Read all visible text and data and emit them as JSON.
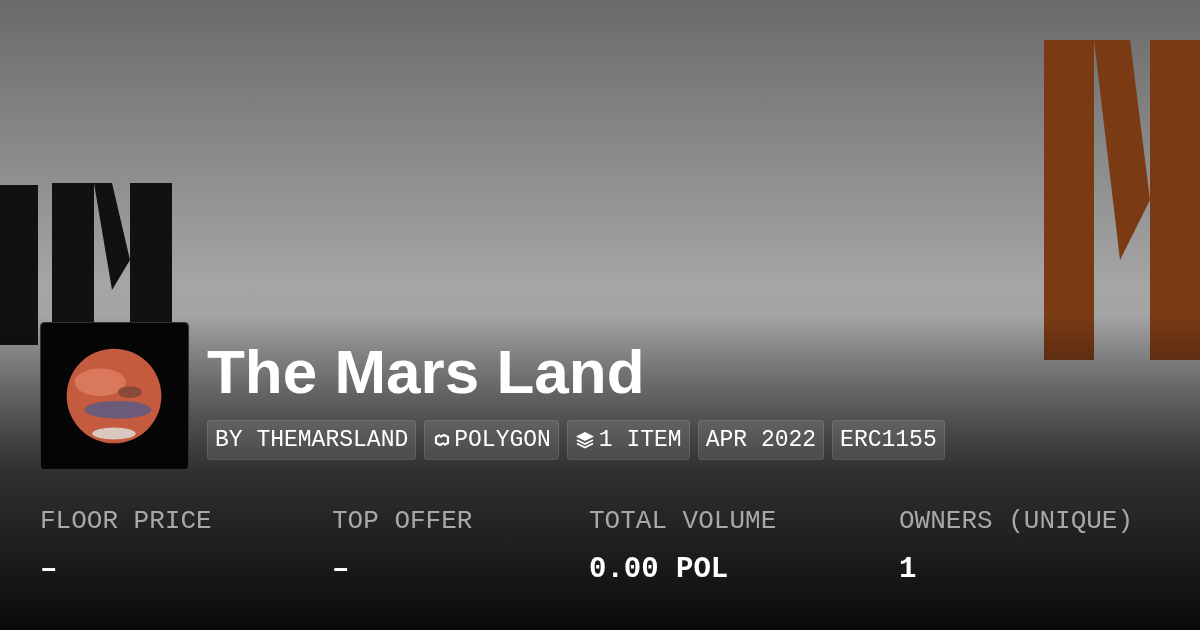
{
  "collection": {
    "name": "The Mars Land"
  },
  "chips": [
    {
      "kind": "text",
      "label": "BY THEMARSLAND"
    },
    {
      "kind": "chain",
      "label": "POLYGON"
    },
    {
      "kind": "items",
      "label": "1 ITEM"
    },
    {
      "kind": "text",
      "label": "APR 2022"
    },
    {
      "kind": "text",
      "label": "ERC1155"
    }
  ],
  "stats": [
    {
      "label": "FLOOR PRICE",
      "value": "–"
    },
    {
      "label": "TOP OFFER",
      "value": "–"
    },
    {
      "label": "TOTAL VOLUME",
      "value": "0.00 POL"
    },
    {
      "label": "OWNERS (UNIQUE)",
      "value": "1"
    }
  ]
}
